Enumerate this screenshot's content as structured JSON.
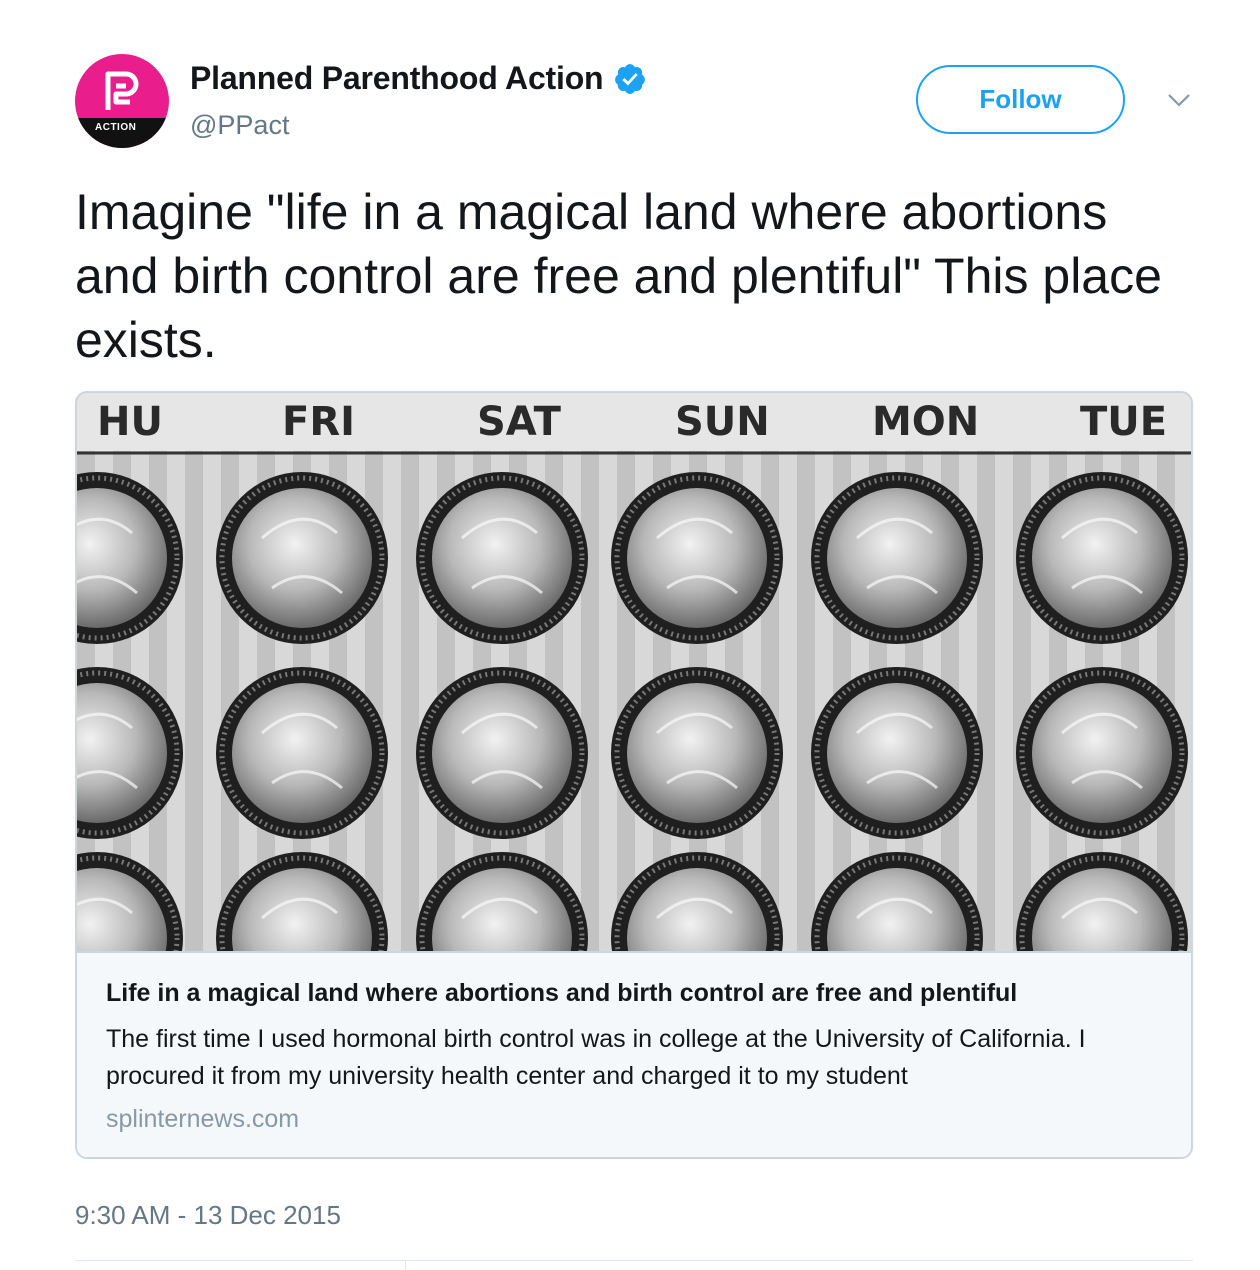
{
  "account": {
    "display_name": "Planned Parenthood Action",
    "handle": "@PPact",
    "avatar_band_text": "ACTION",
    "verified_icon": "verified-badge-icon",
    "brand_color": "#e91e8c"
  },
  "actions": {
    "follow_label": "Follow",
    "more_icon": "chevron-down-icon"
  },
  "tweet": {
    "text": "Imagine \"life in a magical land where abortions and birth control are free and plentiful\" This place exists."
  },
  "card": {
    "image_day_labels": [
      "HU",
      "FRI",
      "SAT",
      "SUN",
      "MON",
      "TUE"
    ],
    "title": "Life in a magical land where abortions and birth control are free and plentiful",
    "description": "The first time I used hormonal birth control was in college at the University of California. I procured it from my university health center and charged it to my student",
    "domain": "splinternews.com"
  },
  "meta": {
    "timestamp": "9:30 AM - 13 Dec 2015"
  },
  "colors": {
    "accent": "#1da1f2",
    "text": "#14171a",
    "secondary": "#657786",
    "card_bg": "#f5f8fa",
    "border": "#ccd6dd"
  }
}
